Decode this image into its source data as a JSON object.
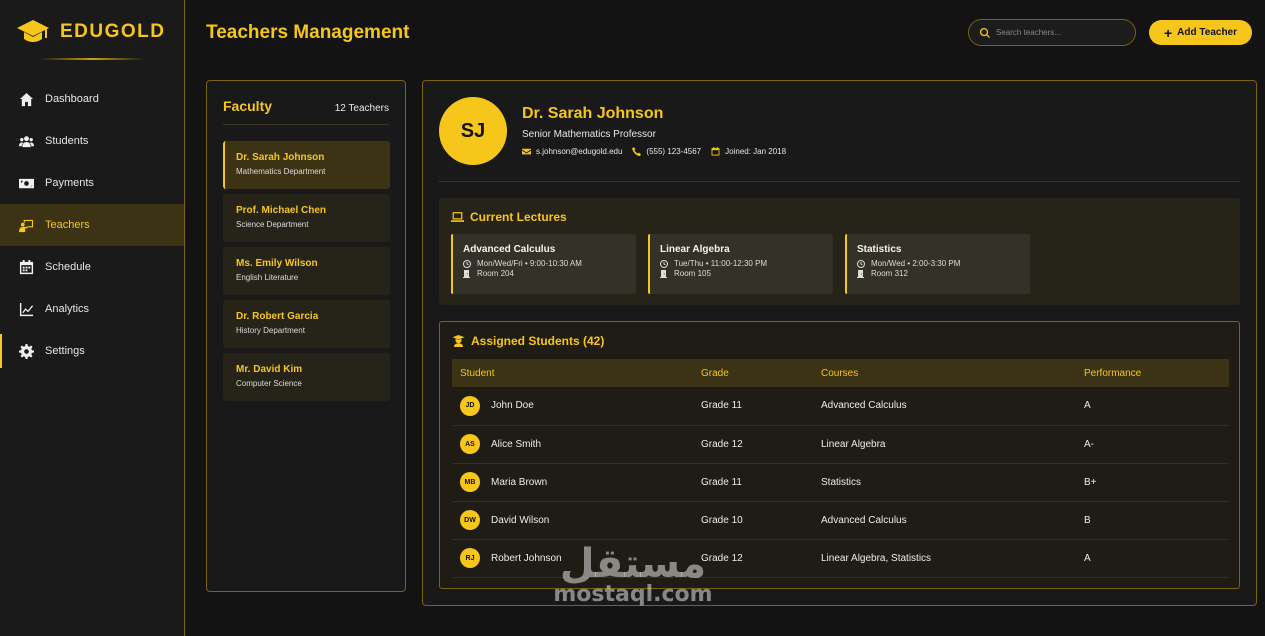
{
  "brand": {
    "name": "EDUGOLD",
    "icon": "graduation-cap-icon"
  },
  "colors": {
    "accent": "#f7c61b",
    "background": "#131313",
    "panel": "#191919",
    "border": "#7a6410"
  },
  "sidebar": {
    "items": [
      {
        "label": "Dashboard",
        "icon": "home-icon",
        "active": false
      },
      {
        "label": "Students",
        "icon": "users-icon",
        "active": false
      },
      {
        "label": "Payments",
        "icon": "money-icon",
        "active": false
      },
      {
        "label": "Teachers",
        "icon": "teacher-icon",
        "active": true
      },
      {
        "label": "Schedule",
        "icon": "calendar-icon",
        "active": false
      },
      {
        "label": "Analytics",
        "icon": "chart-line-icon",
        "active": false
      },
      {
        "label": "Settings",
        "icon": "gear-icon",
        "active": false
      }
    ]
  },
  "header": {
    "title": "Teachers Management",
    "search_placeholder": "Search teachers...",
    "add_button": "Add Teacher"
  },
  "faculty": {
    "title": "Faculty",
    "count": "12 Teachers",
    "teachers": [
      {
        "name": "Dr. Sarah Johnson",
        "dept": "Mathematics Department",
        "active": true
      },
      {
        "name": "Prof. Michael Chen",
        "dept": "Science Department",
        "active": false
      },
      {
        "name": "Ms. Emily Wilson",
        "dept": "English Literature",
        "active": false
      },
      {
        "name": "Dr. Robert Garcia",
        "dept": "History Department",
        "active": false
      },
      {
        "name": "Mr. David Kim",
        "dept": "Computer Science",
        "active": false
      }
    ]
  },
  "profile": {
    "initials": "SJ",
    "name": "Dr. Sarah Johnson",
    "role": "Senior Mathematics Professor",
    "email": "s.johnson@edugold.edu",
    "phone": "(555) 123-4567",
    "joined": "Joined: Jan 2018"
  },
  "lectures": {
    "title": "Current Lectures",
    "items": [
      {
        "name": "Advanced Calculus",
        "time": "Mon/Wed/Fri • 9:00-10:30 AM",
        "room": "Room 204"
      },
      {
        "name": "Linear Algebra",
        "time": "Tue/Thu • 11:00-12:30 PM",
        "room": "Room 105"
      },
      {
        "name": "Statistics",
        "time": "Mon/Wed • 2:00-3:30 PM",
        "room": "Room 312"
      }
    ]
  },
  "students": {
    "title": "Assigned Students (42)",
    "columns": [
      "Student",
      "Grade",
      "Courses",
      "Performance"
    ],
    "rows": [
      {
        "initials": "JD",
        "name": "John Doe",
        "grade": "Grade 11",
        "courses": "Advanced Calculus",
        "performance": "A"
      },
      {
        "initials": "AS",
        "name": "Alice Smith",
        "grade": "Grade 12",
        "courses": "Linear Algebra",
        "performance": "A-"
      },
      {
        "initials": "MB",
        "name": "Maria Brown",
        "grade": "Grade 11",
        "courses": "Statistics",
        "performance": "B+"
      },
      {
        "initials": "DW",
        "name": "David Wilson",
        "grade": "Grade 10",
        "courses": "Advanced Calculus",
        "performance": "B"
      },
      {
        "initials": "RJ",
        "name": "Robert Johnson",
        "grade": "Grade 12",
        "courses": "Linear Algebra, Statistics",
        "performance": "A"
      }
    ]
  },
  "watermark": {
    "arabic": "مستقل",
    "latin": "mostaql.com"
  }
}
